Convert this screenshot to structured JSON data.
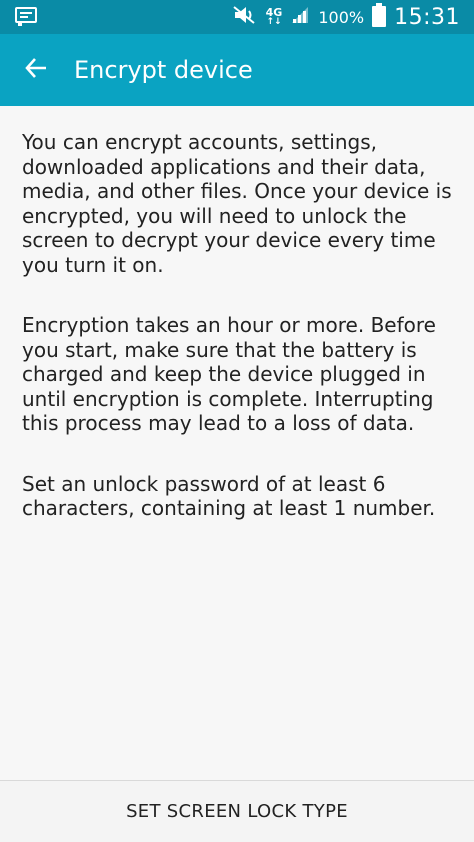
{
  "status_bar": {
    "network_type": "4G",
    "network_arrows": "↑↓",
    "battery_percent": "100%",
    "time": "15:31",
    "icons": [
      "notification-icon",
      "mute-icon",
      "signal-icon",
      "battery-icon"
    ]
  },
  "app_bar": {
    "title": "Encrypt device",
    "back_icon": "back-arrow-icon",
    "background_color": "#0aa3c2",
    "status_color": "#0a8ba6"
  },
  "content": {
    "paragraphs": [
      "You can encrypt accounts, settings, downloaded applications and their data, media, and other files. Once your device is encrypted, you will need to unlock the screen to decrypt your device every time you turn it on.",
      "Encryption takes an hour or more. Before you start, make sure that the battery is charged and keep the device plugged in until encryption is complete. Interrupting this process may lead to a loss of data.",
      "Set an unlock password of at least 6 characters, containing at least 1 number."
    ]
  },
  "bottom_action": {
    "label": "SET SCREEN LOCK TYPE"
  }
}
